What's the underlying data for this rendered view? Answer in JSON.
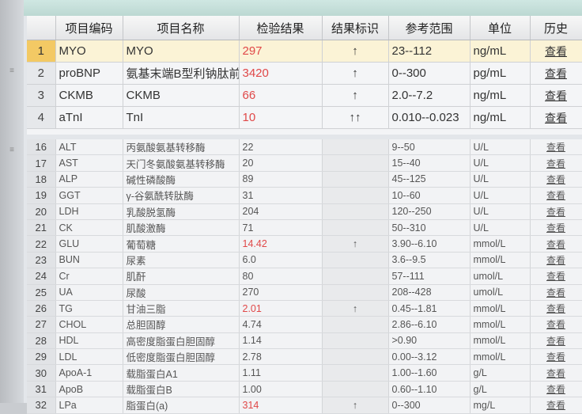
{
  "columns": [
    "项目编码",
    "项目名称",
    "检验结果",
    "结果标识",
    "参考范围",
    "单位",
    "历史"
  ],
  "link_label": "查看",
  "colors": {
    "abnormal": "#e04848",
    "selected_row": "#f3c964",
    "link": "#1a2fa0"
  },
  "top_rows": [
    {
      "no": "1",
      "code": "MYO",
      "name": "MYO",
      "result": "297",
      "flag": "↑",
      "range": "23--112",
      "unit": "ng/mL",
      "abnormal": true
    },
    {
      "no": "2",
      "code": "proBNP",
      "name": "氨基末端B型利钠肽前体",
      "result": "3420",
      "flag": "↑",
      "range": "0--300",
      "unit": "pg/mL",
      "abnormal": true
    },
    {
      "no": "3",
      "code": "CKMB",
      "name": "CKMB",
      "result": "66",
      "flag": "↑",
      "range": "2.0--7.2",
      "unit": "ng/mL",
      "abnormal": true
    },
    {
      "no": "4",
      "code": "aTnI",
      "name": "TnI",
      "result": "10",
      "flag": "↑↑",
      "range": "0.010--0.023",
      "unit": "ng/mL",
      "abnormal": true
    }
  ],
  "bottom_rows": [
    {
      "no": "16",
      "code": "ALT",
      "name": "丙氨酸氨基转移酶",
      "result": "22",
      "flag": "",
      "range": "9--50",
      "unit": "U/L",
      "abnormal": false
    },
    {
      "no": "17",
      "code": "AST",
      "name": "天门冬氨酸氨基转移酶",
      "result": "20",
      "flag": "",
      "range": "15--40",
      "unit": "U/L",
      "abnormal": false
    },
    {
      "no": "18",
      "code": "ALP",
      "name": "碱性磷酸酶",
      "result": "89",
      "flag": "",
      "range": "45--125",
      "unit": "U/L",
      "abnormal": false
    },
    {
      "no": "19",
      "code": "GGT",
      "name": "γ-谷氨酰转肽酶",
      "result": "31",
      "flag": "",
      "range": "10--60",
      "unit": "U/L",
      "abnormal": false
    },
    {
      "no": "20",
      "code": "LDH",
      "name": "乳酸脱氢酶",
      "result": "204",
      "flag": "",
      "range": "120--250",
      "unit": "U/L",
      "abnormal": false
    },
    {
      "no": "21",
      "code": "CK",
      "name": "肌酸激酶",
      "result": "71",
      "flag": "",
      "range": "50--310",
      "unit": "U/L",
      "abnormal": false
    },
    {
      "no": "22",
      "code": "GLU",
      "name": "葡萄糖",
      "result": "14.42",
      "flag": "↑",
      "range": "3.90--6.10",
      "unit": "mmol/L",
      "abnormal": true
    },
    {
      "no": "23",
      "code": "BUN",
      "name": "尿素",
      "result": "6.0",
      "flag": "",
      "range": "3.6--9.5",
      "unit": "mmol/L",
      "abnormal": false
    },
    {
      "no": "24",
      "code": "Cr",
      "name": "肌酐",
      "result": "80",
      "flag": "",
      "range": "57--111",
      "unit": "umol/L",
      "abnormal": false
    },
    {
      "no": "25",
      "code": "UA",
      "name": "尿酸",
      "result": "270",
      "flag": "",
      "range": "208--428",
      "unit": "umol/L",
      "abnormal": false
    },
    {
      "no": "26",
      "code": "TG",
      "name": "甘油三脂",
      "result": "2.01",
      "flag": "↑",
      "range": "0.45--1.81",
      "unit": "mmol/L",
      "abnormal": true
    },
    {
      "no": "27",
      "code": "CHOL",
      "name": "总胆固醇",
      "result": "4.74",
      "flag": "",
      "range": "2.86--6.10",
      "unit": "mmol/L",
      "abnormal": false
    },
    {
      "no": "28",
      "code": "HDL",
      "name": "高密度脂蛋白胆固醇",
      "result": "1.14",
      "flag": "",
      "range": ">0.90",
      "unit": "mmol/L",
      "abnormal": false
    },
    {
      "no": "29",
      "code": "LDL",
      "name": "低密度脂蛋白胆固醇",
      "result": "2.78",
      "flag": "",
      "range": "0.00--3.12",
      "unit": "mmol/L",
      "abnormal": false
    },
    {
      "no": "30",
      "code": "ApoA-1",
      "name": "载脂蛋白A1",
      "result": "1.11",
      "flag": "",
      "range": "1.00--1.60",
      "unit": "g/L",
      "abnormal": false
    },
    {
      "no": "31",
      "code": "ApoB",
      "name": "载脂蛋白B",
      "result": "1.00",
      "flag": "",
      "range": "0.60--1.10",
      "unit": "g/L",
      "abnormal": false
    },
    {
      "no": "32",
      "code": "LPa",
      "name": "脂蛋白(a)",
      "result": "314",
      "flag": "↑",
      "range": "0--300",
      "unit": "mg/L",
      "abnormal": true
    }
  ]
}
